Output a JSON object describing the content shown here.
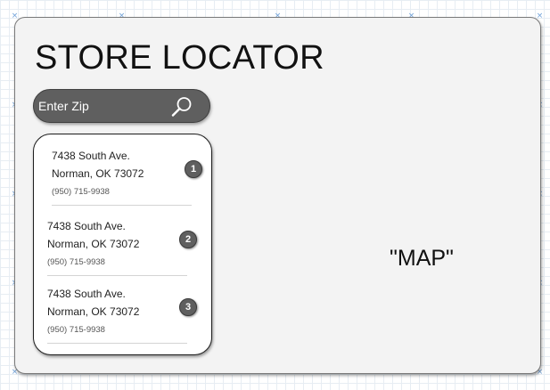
{
  "header": {
    "title": "STORE LOCATOR"
  },
  "search": {
    "placeholder": "Enter Zip",
    "value": "",
    "icon": "search-icon"
  },
  "results": [
    {
      "number": "1",
      "street": "7438 South Ave.",
      "city_line": "Norman, OK 73072",
      "phone": "(950) 715-9938"
    },
    {
      "number": "2",
      "street": "7438 South Ave.",
      "city_line": "Norman, OK 73072",
      "phone": "(950) 715-9938"
    },
    {
      "number": "3",
      "street": "7438 South Ave.",
      "city_line": "Norman, OK 73072",
      "phone": "(950) 715-9938"
    }
  ],
  "map": {
    "label": "\"MAP\""
  },
  "colors": {
    "frame_background": "#f3f3f3",
    "search_bar": "#5f5f5f",
    "badge": "#5f5f5f",
    "selection_marker": "#6ea0d8"
  }
}
